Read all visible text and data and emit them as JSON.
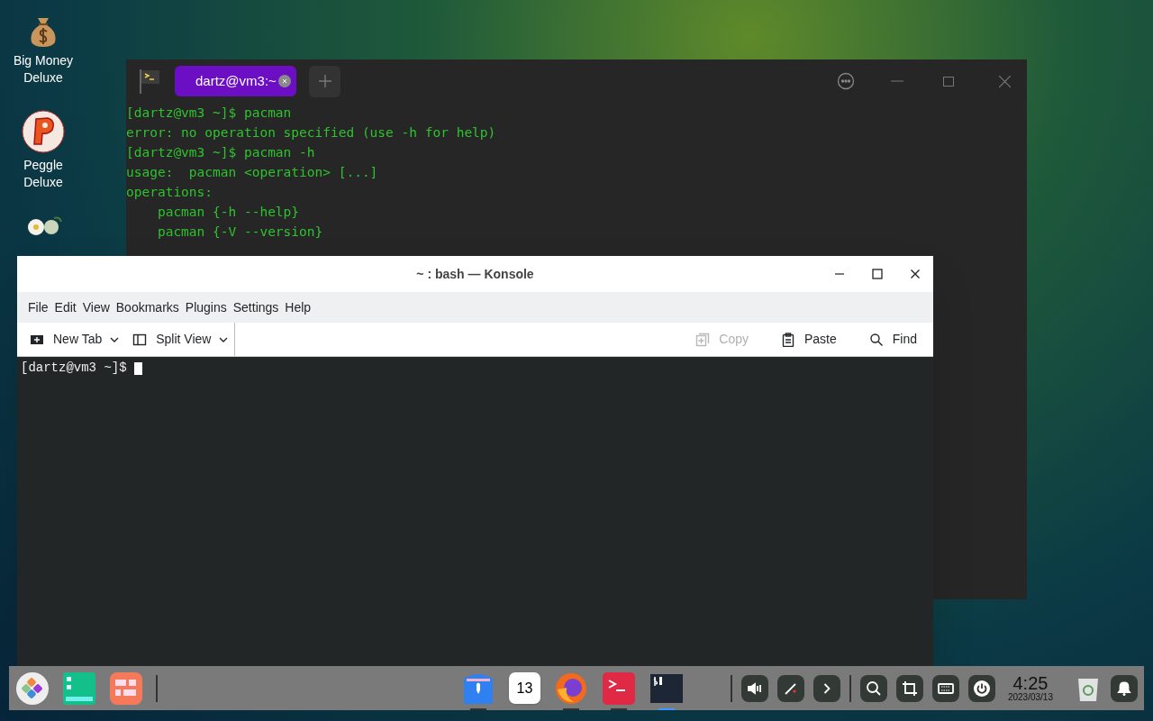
{
  "desktop_icons": [
    {
      "kind": "money-bag",
      "label": "Big Money Deluxe"
    },
    {
      "kind": "peggle",
      "label": "Peggle Deluxe"
    },
    {
      "kind": "flowers"
    }
  ],
  "back_terminal": {
    "tabs": [
      {
        "label": "dartz@vm3:~",
        "selected": true
      }
    ],
    "lines": [
      "[dartz@vm3 ~]$ pacman",
      "error: no operation specified (use -h for help)",
      "[dartz@vm3 ~]$ pacman -h",
      "usage:  pacman <operation> [...]",
      "operations:",
      "    pacman {-h --help}",
      "    pacman {-V --version}"
    ]
  },
  "konsole": {
    "title": "~ : bash — Konsole",
    "menu": [
      "File",
      "Edit",
      "View",
      "Bookmarks",
      "Plugins",
      "Settings",
      "Help"
    ],
    "toolbar_left": [
      {
        "kind": "new-tab",
        "label": "New Tab"
      },
      {
        "kind": "split",
        "label": "Split View"
      }
    ],
    "toolbar_right": [
      {
        "kind": "copy",
        "label": "Copy",
        "disabled": true
      },
      {
        "kind": "paste",
        "label": "Paste",
        "disabled": false
      },
      {
        "kind": "find",
        "label": "Find",
        "disabled": false
      }
    ],
    "prompt": "[dartz@vm3 ~]$ "
  },
  "taskbar": {
    "launchers": [
      {
        "kind": "launcher"
      },
      {
        "kind": "multitask"
      },
      {
        "kind": "workspace"
      }
    ],
    "apps": [
      {
        "kind": "store",
        "running": true,
        "active": false
      },
      {
        "kind": "calendar",
        "day": "13",
        "running": false,
        "active": false
      },
      {
        "kind": "firefox",
        "running": true,
        "active": false
      },
      {
        "kind": "red-terminal",
        "running": true,
        "active": false
      },
      {
        "kind": "dark-terminal",
        "running": true,
        "active": true
      }
    ],
    "tray": [
      {
        "kind": "volume"
      },
      {
        "kind": "pen"
      },
      {
        "kind": "arrow"
      }
    ],
    "tools": [
      {
        "kind": "search"
      },
      {
        "kind": "crop"
      },
      {
        "kind": "keyboard"
      },
      {
        "kind": "power"
      }
    ],
    "time": "4:25",
    "date": "2023/03/13"
  }
}
